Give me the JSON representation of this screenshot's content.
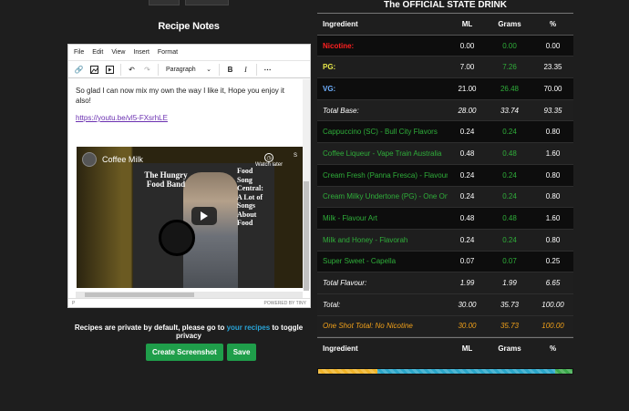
{
  "left": {
    "title": "Recipe Notes",
    "menu": [
      "File",
      "Edit",
      "View",
      "Insert",
      "Format"
    ],
    "format_select": "Paragraph",
    "note_text": "So glad I can now mix my own the way I like it, Hope you enjoy it also!",
    "note_link": "https://youtu.be/vl5-FXsrhLE",
    "video": {
      "channel": "Coffee Milk",
      "thumb_title": "The Hungry Food Band",
      "thumb_caption": "Food Song Central: A Lot of Songs About Food",
      "watch_later": "Watch later",
      "share": "S"
    },
    "status_left": "P",
    "status_right": "POWERED BY TINY",
    "privacy_pre": "Recipes are private by default, please go to",
    "privacy_link": "your recipes",
    "privacy_post": "to toggle privacy",
    "btn_screenshot": "Create Screenshot",
    "btn_save": "Save"
  },
  "table": {
    "title": "The OFFICIAL STATE DRINK",
    "headers": {
      "name": "Ingredient",
      "ml": "ML",
      "grams": "Grams",
      "pct": "%"
    },
    "rows": [
      {
        "name": "Nicotine:",
        "ml": "0.00",
        "grams": "0.00",
        "pct": "0.00",
        "style": "nic"
      },
      {
        "name": "PG:",
        "ml": "7.00",
        "grams": "7.26",
        "pct": "23.35",
        "style": "pg"
      },
      {
        "name": "VG:",
        "ml": "21.00",
        "grams": "26.48",
        "pct": "70.00",
        "style": "vg"
      },
      {
        "name": "Total Base:",
        "ml": "28.00",
        "grams": "33.74",
        "pct": "93.35",
        "style": "total"
      },
      {
        "name": "Cappuccino (SC) - Bull City Flavors",
        "ml": "0.24",
        "grams": "0.24",
        "pct": "0.80",
        "style": "flavor"
      },
      {
        "name": "Coffee Liqueur - Vape Train Australia",
        "ml": "0.48",
        "grams": "0.48",
        "pct": "1.60",
        "style": "flavor"
      },
      {
        "name": "Cream Fresh (Panna Fresca) - Flavour Art",
        "ml": "0.24",
        "grams": "0.24",
        "pct": "0.80",
        "style": "flavor"
      },
      {
        "name": "Cream Milky Undertone (PG) - One On One",
        "ml": "0.24",
        "grams": "0.24",
        "pct": "0.80",
        "style": "flavor"
      },
      {
        "name": "Milk - Flavour Art",
        "ml": "0.48",
        "grams": "0.48",
        "pct": "1.60",
        "style": "flavor"
      },
      {
        "name": "Milk and Honey - Flavorah",
        "ml": "0.24",
        "grams": "0.24",
        "pct": "0.80",
        "style": "flavor"
      },
      {
        "name": "Super Sweet - Capella",
        "ml": "0.07",
        "grams": "0.07",
        "pct": "0.25",
        "style": "flavor"
      },
      {
        "name": "Total Flavour:",
        "ml": "1.99",
        "grams": "1.99",
        "pct": "6.65",
        "style": "total"
      },
      {
        "name": "Total:",
        "ml": "30.00",
        "grams": "35.73",
        "pct": "100.00",
        "style": "total"
      },
      {
        "name": "One Shot Total: No Nicotine",
        "ml": "30.00",
        "grams": "35.73",
        "pct": "100.00",
        "style": "oneshot"
      }
    ],
    "bar_segments": [
      {
        "name": "pg",
        "pct": 23.35,
        "color": "#f0b429"
      },
      {
        "name": "vg",
        "pct": 70.0,
        "color": "#2aa6c9"
      },
      {
        "name": "flavour",
        "pct": 6.65,
        "color": "#3aa84a"
      }
    ]
  }
}
